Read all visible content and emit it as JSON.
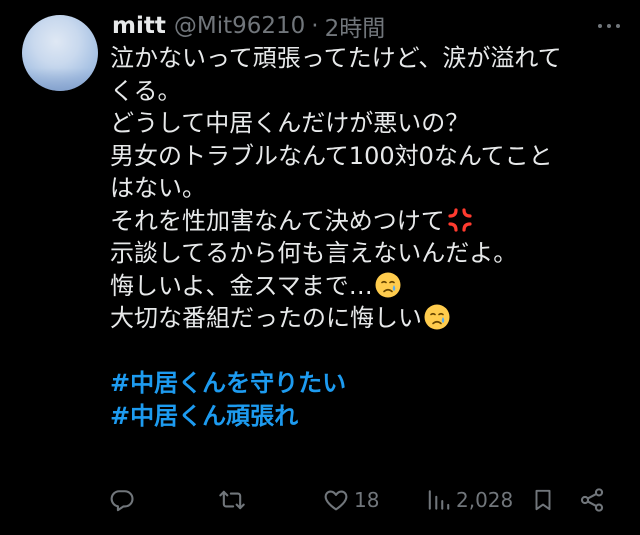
{
  "author": {
    "name": "mitt",
    "handle": "@Mit96210",
    "separator": "·",
    "time": "2時間"
  },
  "tweet": {
    "lines": [
      "泣かないって頑張ってたけど、涙が溢れて",
      "くる。",
      "どうして中居くんだけが悪いの？",
      "男女のトラブルなんて100対0なんてこと",
      "はない。",
      "それを性加害なんて決めつけて",
      "示談してるから何も言えないんだよ。",
      "悔しいよ、金スマまで…",
      "大切な番組だったのに悔しい"
    ],
    "hashtags": [
      "#中居くんを守りたい",
      "#中居くん頑張れ"
    ]
  },
  "icons": {
    "anger": "anger-symbol-icon",
    "crying1": "crying-face-icon",
    "crying2": "crying-face-icon",
    "more": "more-icon",
    "reply": "reply-icon",
    "retweet": "retweet-icon",
    "like": "heart-icon",
    "views": "views-icon",
    "bookmark": "bookmark-icon",
    "share": "share-icon"
  },
  "actions": {
    "likes": "18",
    "views": "2,028"
  },
  "colors": {
    "background": "#000000",
    "text": "#e7e9ea",
    "secondary": "#71767b",
    "link": "#1d9bf0"
  }
}
